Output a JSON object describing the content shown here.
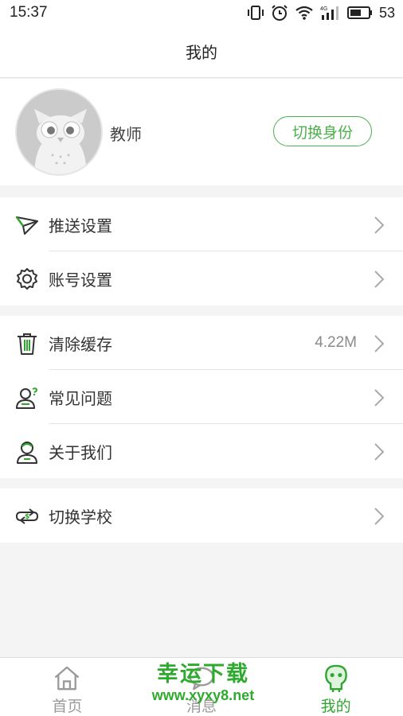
{
  "status_bar": {
    "time": "15:37",
    "battery": "53",
    "network": "4G"
  },
  "header": {
    "title": "我的"
  },
  "profile": {
    "role": "教师",
    "switch_label": "切换身份"
  },
  "menu_groups": [
    {
      "items": [
        {
          "label": "推送设置",
          "icon": "paper-plane-icon"
        },
        {
          "label": "账号设置",
          "icon": "gear-icon"
        }
      ]
    },
    {
      "items": [
        {
          "label": "清除缓存",
          "icon": "trash-icon",
          "value": "4.22M"
        },
        {
          "label": "常见问题",
          "icon": "question-person-icon"
        },
        {
          "label": "关于我们",
          "icon": "person-icon"
        }
      ]
    },
    {
      "items": [
        {
          "label": "切换学校",
          "icon": "switch-arrows-icon"
        }
      ]
    }
  ],
  "tabs": [
    {
      "label": "首页",
      "icon": "home-icon",
      "active": false
    },
    {
      "label": "消息",
      "icon": "message-icon",
      "active": false
    },
    {
      "label": "我的",
      "icon": "mine-icon",
      "active": true
    }
  ],
  "watermark": {
    "title": "幸运下载",
    "url": "www.xyxy8.net"
  },
  "colors": {
    "accent": "#4cb14c",
    "tab_active": "#2fa62f",
    "background": "#f4f4f4"
  }
}
